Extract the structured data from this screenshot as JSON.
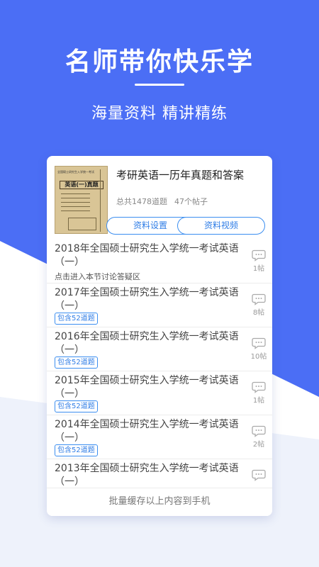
{
  "colors": {
    "brand_blue": "#4b6ef5",
    "accent": "#3b8ef0",
    "light_bg": "#eef2fb"
  },
  "hero": {
    "headline": "名师带你快乐学",
    "subline": "海量资料 精讲精练"
  },
  "book": {
    "title": "考研英语一历年真题和答案",
    "total_questions": "总共1478道题",
    "posts": "47个帖子",
    "cover_text": {
      "top": "全国硕士研究生入学统一考试",
      "title": "英语(一)真题"
    },
    "settings_button": "资料设置",
    "video_button": "资料视频"
  },
  "items": [
    {
      "title": "2018年全国硕士研究生入学统一考试英语（一）",
      "hint": "点击进入本节讨论答疑区",
      "tag": "",
      "comments": "1帖"
    },
    {
      "title": "2017年全国硕士研究生入学统一考试英语（一）",
      "hint": "",
      "tag": "包含52道题",
      "comments": "8帖"
    },
    {
      "title": "2016年全国硕士研究生入学统一考试英语（一）",
      "hint": "",
      "tag": "包含52道题",
      "comments": "10帖"
    },
    {
      "title": "2015年全国硕士研究生入学统一考试英语（一）",
      "hint": "",
      "tag": "包含52道题",
      "comments": "1帖"
    },
    {
      "title": "2014年全国硕士研究生入学统一考试英语（一）",
      "hint": "",
      "tag": "包含52道题",
      "comments": "2帖"
    },
    {
      "title": "2013年全国硕士研究生入学统一考试英语（一）",
      "hint": "",
      "tag": "",
      "comments": ""
    }
  ],
  "footer": {
    "label": "批量缓存以上内容到手机"
  }
}
